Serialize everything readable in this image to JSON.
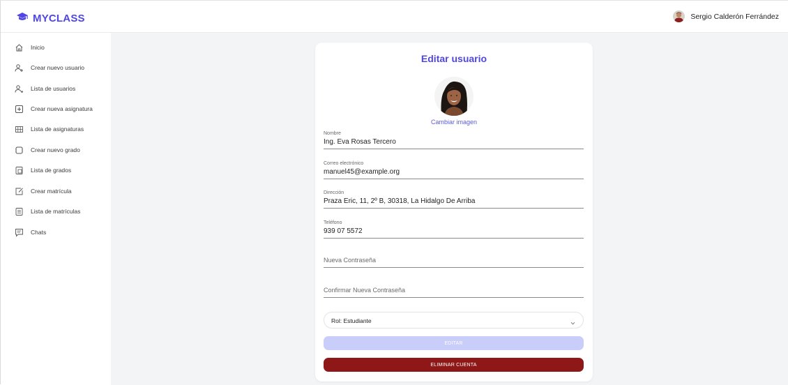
{
  "app": {
    "brand": "MYCLASS",
    "brand_color": "#4f46e5"
  },
  "header": {
    "user_name": "Sergio Calderón Ferrández"
  },
  "sidebar": {
    "items": [
      {
        "label": "Inicio",
        "icon": "home-icon"
      },
      {
        "label": "Crear nuevo usuario",
        "icon": "user-plus-icon"
      },
      {
        "label": "Lista de usuarios",
        "icon": "users-list-icon"
      },
      {
        "label": "Crear nueva asignatura",
        "icon": "add-square-icon"
      },
      {
        "label": "Lista de asignaturas",
        "icon": "grid-list-icon"
      },
      {
        "label": "Crear nuevo grado",
        "icon": "square-icon"
      },
      {
        "label": "Lista de grados",
        "icon": "document-list-icon"
      },
      {
        "label": "Crear matrícula",
        "icon": "edit-note-icon"
      },
      {
        "label": "Lista de matrículas",
        "icon": "table-list-icon"
      },
      {
        "label": "Chats",
        "icon": "chat-icon"
      }
    ]
  },
  "form": {
    "title": "Editar usuario",
    "change_image": "Cambiar imagen",
    "name": {
      "label": "Nombre",
      "value": "Ing. Eva Rosas Tercero"
    },
    "email": {
      "label": "Correo electrónico",
      "value": "manuel45@example.org"
    },
    "address": {
      "label": "Dirección",
      "value": "Praza Eric, 11, 2º B, 30318, La Hidalgo De Arriba"
    },
    "phone": {
      "label": "Teléfono",
      "value": "939 07 5572"
    },
    "new_password": {
      "placeholder": "Nueva Contraseña"
    },
    "confirm_password": {
      "placeholder": "Confirmar Nueva Contraseña"
    },
    "role": {
      "value": "Rol: Estudiante"
    },
    "edit_button": "EDITAR",
    "delete_button": "ELIMINAR CUENTA"
  },
  "colors": {
    "accent": "#4f46e5",
    "danger": "#8e1717",
    "disabled_button": "#c9cdf9",
    "background": "#f3f4f6"
  }
}
